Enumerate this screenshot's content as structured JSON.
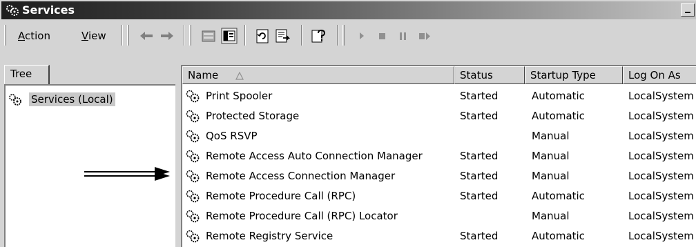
{
  "window": {
    "title": "Services"
  },
  "toolbar": {
    "action_label": "Action",
    "action_mnemonic": "A",
    "action_rest": "ction",
    "view_label": "View",
    "view_mnemonic": "V",
    "view_rest": "iew"
  },
  "tree": {
    "tab_label": "Tree",
    "root_label": "Services (Local)"
  },
  "list": {
    "columns": [
      "Name",
      "Status",
      "Startup Type",
      "Log On As"
    ],
    "rows": [
      {
        "name": "Print Spooler",
        "status": "Started",
        "startup": "Automatic",
        "logon": "LocalSystem"
      },
      {
        "name": "Protected Storage",
        "status": "Started",
        "startup": "Automatic",
        "logon": "LocalSystem"
      },
      {
        "name": "QoS RSVP",
        "status": "",
        "startup": "Manual",
        "logon": "LocalSystem"
      },
      {
        "name": "Remote Access Auto Connection Manager",
        "status": "Started",
        "startup": "Manual",
        "logon": "LocalSystem"
      },
      {
        "name": "Remote Access Connection Manager",
        "status": "Started",
        "startup": "Manual",
        "logon": "LocalSystem"
      },
      {
        "name": "Remote Procedure Call (RPC)",
        "status": "Started",
        "startup": "Automatic",
        "logon": "LocalSystem"
      },
      {
        "name": "Remote Procedure Call (RPC) Locator",
        "status": "",
        "startup": "Manual",
        "logon": "LocalSystem"
      },
      {
        "name": "Remote Registry Service",
        "status": "Started",
        "startup": "Automatic",
        "logon": "LocalSystem"
      }
    ]
  },
  "icons": [
    "services-icon",
    "back-arrow-icon",
    "forward-arrow-icon",
    "folder-icon",
    "console-tree-icon",
    "refresh-icon",
    "export-list-icon",
    "help-icon",
    "play-icon",
    "stop-icon",
    "pause-icon",
    "restart-icon",
    "gear-icon",
    "sort-ascending-icon",
    "annotation-arrow-icon"
  ]
}
